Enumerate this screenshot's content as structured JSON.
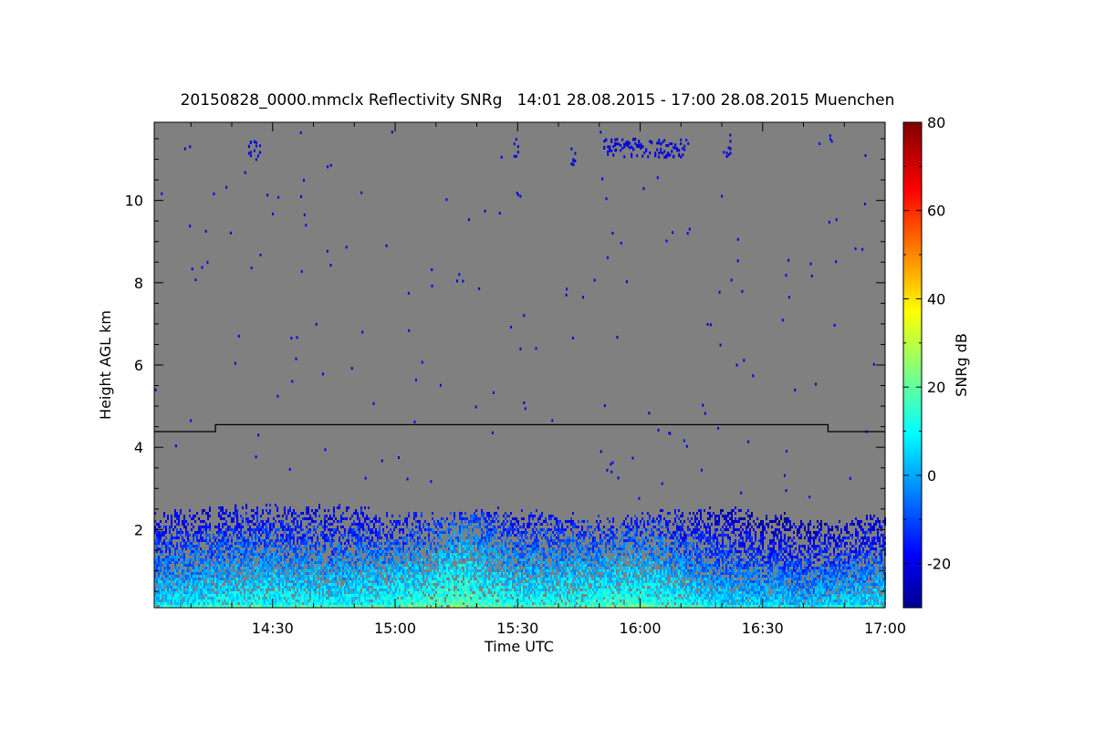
{
  "chart_data": {
    "type": "heatmap",
    "title": "20150828_0000.mmclx Reflectivity SNRg   14:01 28.08.2015 - 17:00 28.08.2015 Muenchen",
    "xlabel": "Time UTC",
    "ylabel": "Height AGL km",
    "xlim": [
      "14:01",
      "17:00"
    ],
    "ylim": [
      0.1,
      11.9
    ],
    "x_ticks": [
      "14:30",
      "15:00",
      "15:30",
      "16:00",
      "16:30",
      "17:00"
    ],
    "y_ticks": [
      2,
      4,
      6,
      8,
      10
    ],
    "background_color": "#808080",
    "colorbar": {
      "label": "SNRg dB",
      "range": [
        -30,
        80
      ],
      "ticks": [
        -20,
        0,
        20,
        40,
        60,
        80
      ],
      "colormap": "jet"
    },
    "overlay_line": {
      "points": [
        {
          "time": "14:01",
          "height_km": 4.38
        },
        {
          "time": "14:16",
          "height_km": 4.38
        },
        {
          "time": "14:16",
          "height_km": 4.55
        },
        {
          "time": "16:46",
          "height_km": 4.55
        },
        {
          "time": "16:46",
          "height_km": 4.38
        },
        {
          "time": "17:00",
          "height_km": 4.38
        }
      ],
      "color": "#000000"
    },
    "echo_summary": {
      "boundary_layer_top_km": [
        {
          "time": "14:05",
          "height_km": 2.4
        },
        {
          "time": "14:20",
          "height_km": 2.5
        },
        {
          "time": "14:35",
          "height_km": 2.6
        },
        {
          "time": "14:50",
          "height_km": 2.5
        },
        {
          "time": "15:05",
          "height_km": 2.3
        },
        {
          "time": "15:20",
          "height_km": 2.5
        },
        {
          "time": "15:35",
          "height_km": 2.4
        },
        {
          "time": "15:50",
          "height_km": 2.3
        },
        {
          "time": "16:05",
          "height_km": 2.4
        },
        {
          "time": "16:20",
          "height_km": 2.5
        },
        {
          "time": "16:35",
          "height_km": 2.3
        },
        {
          "time": "16:50",
          "height_km": 2.2
        },
        {
          "time": "17:00",
          "height_km": 2.4
        }
      ],
      "snr_near_surface_db": [
        {
          "time": "14:05",
          "value": 10
        },
        {
          "time": "14:25",
          "value": 14
        },
        {
          "time": "14:45",
          "value": 12
        },
        {
          "time": "15:00",
          "value": 15
        },
        {
          "time": "15:15",
          "value": 22
        },
        {
          "time": "15:30",
          "value": 14
        },
        {
          "time": "15:45",
          "value": 16
        },
        {
          "time": "16:00",
          "value": 18
        },
        {
          "time": "16:20",
          "value": 8
        },
        {
          "time": "16:40",
          "value": 6
        },
        {
          "time": "17:00",
          "value": 10
        }
      ],
      "upper_cloud_patches": [
        {
          "start": "14:24",
          "end": "14:27",
          "height_km": 11.25,
          "snr_db": -20
        },
        {
          "start": "15:29",
          "end": "15:30",
          "height_km": 11.3,
          "snr_db": -20
        },
        {
          "start": "15:43",
          "end": "15:44",
          "height_km": 11.1,
          "snr_db": -20
        },
        {
          "start": "15:51",
          "end": "16:12",
          "height_km": 11.3,
          "snr_db": -20
        },
        {
          "start": "16:21",
          "end": "16:22",
          "height_km": 11.3,
          "snr_db": -20
        }
      ]
    }
  }
}
